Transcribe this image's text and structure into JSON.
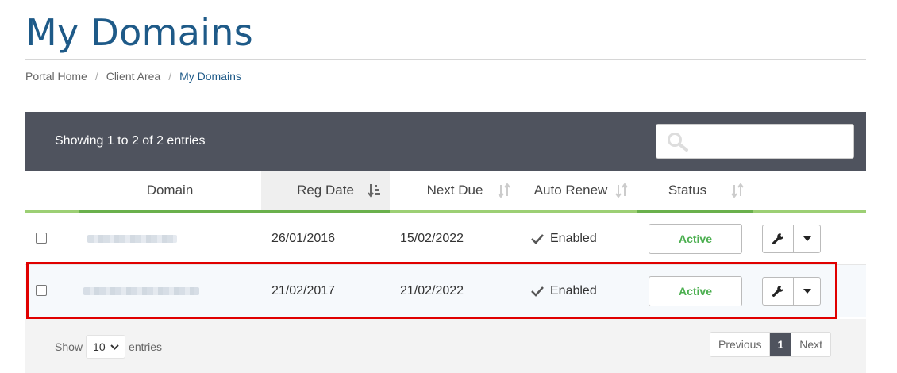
{
  "page": {
    "title": "My Domains"
  },
  "breadcrumb": {
    "items": [
      "Portal Home",
      "Client Area",
      "My Domains"
    ]
  },
  "table": {
    "showing_text": "Showing 1 to 2 of 2 entries",
    "search": {
      "placeholder": ""
    },
    "columns": [
      "Domain",
      "Reg Date",
      "Next Due",
      "Auto Renew",
      "Status"
    ],
    "rows": [
      {
        "reg_date": "26/01/2016",
        "next_due": "15/02/2022",
        "auto_renew": "Enabled",
        "status": "Active"
      },
      {
        "reg_date": "21/02/2017",
        "next_due": "21/02/2022",
        "auto_renew": "Enabled",
        "status": "Active"
      }
    ]
  },
  "footer": {
    "show_label": "Show",
    "page_size": "10",
    "entries_label": "entries",
    "pagination": {
      "previous": "Previous",
      "current": "1",
      "next": "Next"
    }
  },
  "colors": {
    "title": "#1e5a88",
    "topbar": "#4f535e",
    "accent_green": "#6ab04c",
    "status_active": "#4caf50",
    "highlight": "#e00000"
  },
  "icons": [
    "search-icon",
    "sort-icon",
    "check-icon",
    "wrench-icon",
    "caret-down-icon",
    "chevron-down-icon"
  ]
}
